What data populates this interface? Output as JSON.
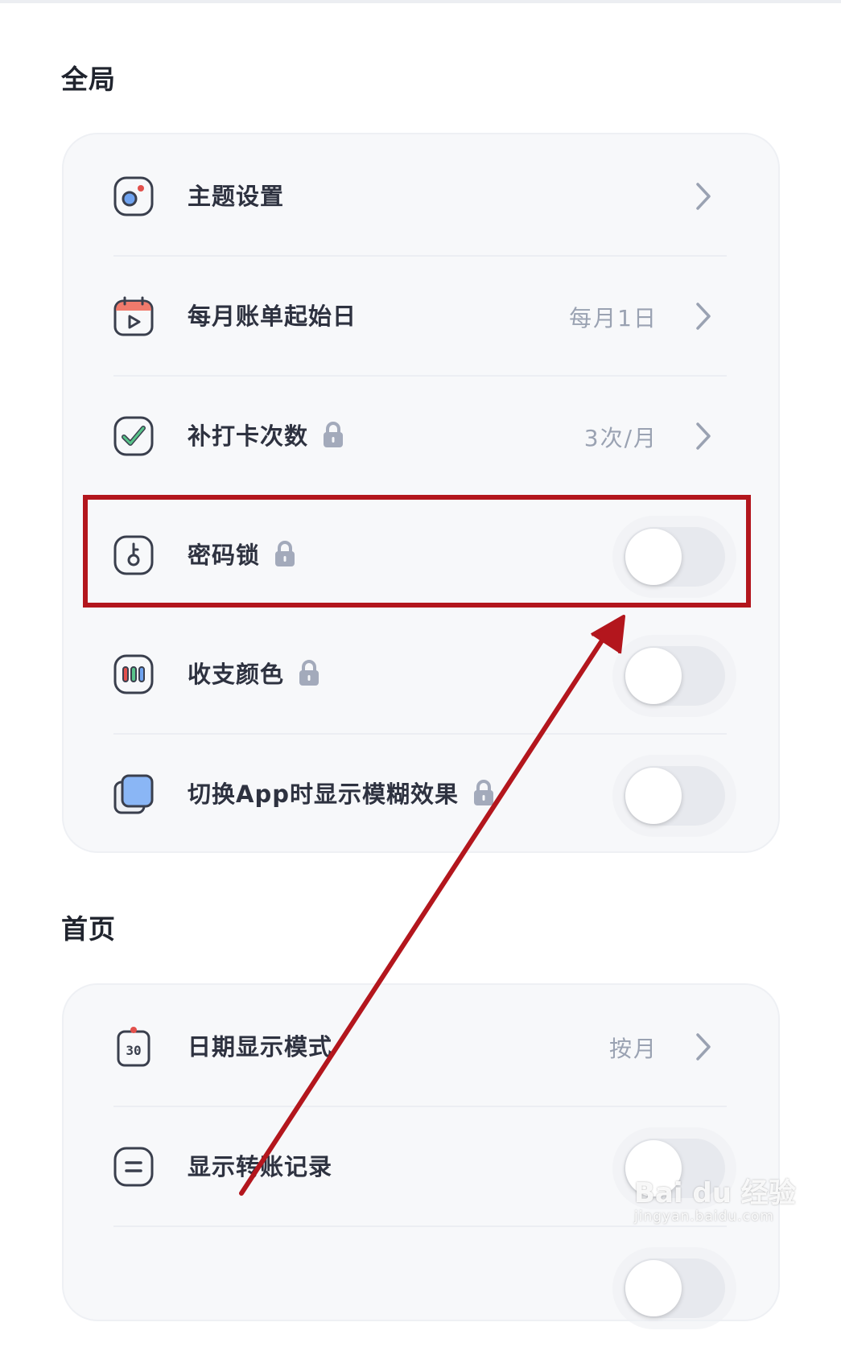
{
  "sections": [
    {
      "title": "全局"
    },
    {
      "title": "首页"
    }
  ],
  "global": {
    "theme": {
      "label": "主题设置",
      "icon": "palette-icon"
    },
    "billing_start": {
      "label": "每月账单起始日",
      "value": "每月1日",
      "icon": "calendar-icon"
    },
    "makeup_checkin": {
      "label": "补打卡次数",
      "value": "3次/月",
      "icon": "checkmark-icon",
      "locked": true
    },
    "password_lock": {
      "label": "密码锁",
      "enabled": false,
      "icon": "key-icon",
      "locked": true
    },
    "income_color": {
      "label": "收支颜色",
      "enabled": false,
      "icon": "color-bars-icon",
      "locked": true
    },
    "blur_on_switch": {
      "label": "切换App时显示模糊效果",
      "enabled": false,
      "icon": "blur-layers-icon",
      "locked": true
    }
  },
  "home": {
    "date_mode": {
      "label": "日期显示模式",
      "value": "按月",
      "icon": "calendar-30-icon"
    },
    "show_transfer": {
      "label": "显示转账记录",
      "enabled": false,
      "icon": "equals-icon"
    }
  },
  "colors": {
    "highlight": "#b3161d",
    "card_bg": "#f7f8fa",
    "value_text": "#9aa2b2"
  },
  "watermark": {
    "logo": "Bai du 经验",
    "url": "jingyan.baidu.com"
  }
}
